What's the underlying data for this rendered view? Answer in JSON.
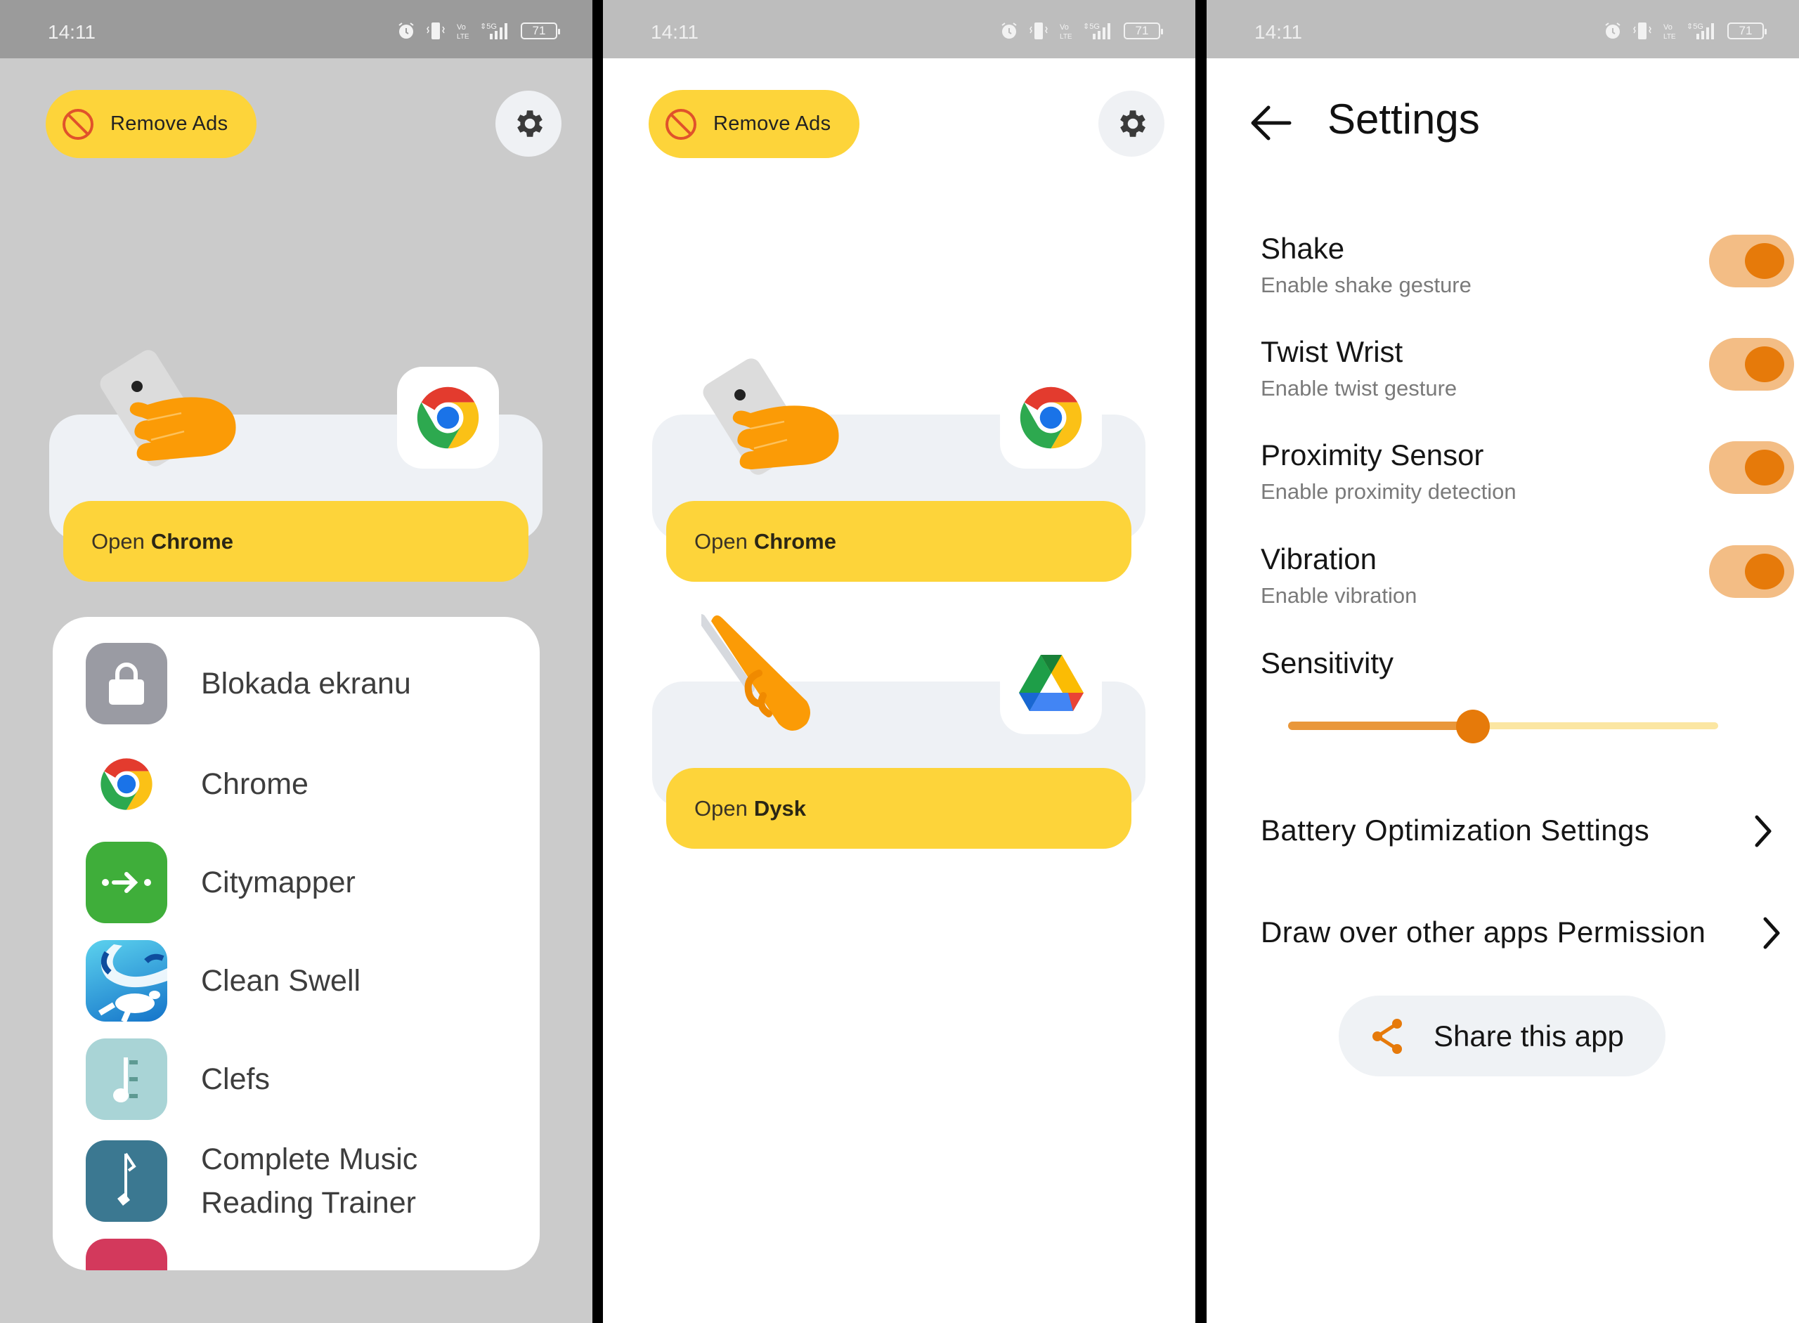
{
  "status_bar": {
    "time": "14:11",
    "icons": [
      "alarm-icon",
      "vibrate-icon",
      "volte-icon",
      "5g-signal-icon",
      "battery-icon"
    ],
    "volte_label": "Vo LTE",
    "network_label": "5G",
    "battery_level": "71"
  },
  "home": {
    "remove_ads_label": "Remove Ads",
    "settings_icon": "gear-icon",
    "gestures": [
      {
        "gesture": "shake-hand",
        "app": "Chrome",
        "open_prefix": "Open",
        "open_app": "Chrome"
      },
      {
        "gesture": "swipe-hand",
        "app": "Dysk",
        "open_prefix": "Open",
        "open_app": "Dysk"
      }
    ]
  },
  "app_picker": {
    "items": [
      {
        "name": "Blokada ekranu",
        "icon": "lock-icon",
        "color": "#9a9ba3"
      },
      {
        "name": "Chrome",
        "icon": "chrome-icon",
        "color": "#ffffff"
      },
      {
        "name": "Citymapper",
        "icon": "citymapper-icon",
        "color": "#3fae3a"
      },
      {
        "name": "Clean Swell",
        "icon": "wave-turtle-icon",
        "color": "#1e90d6"
      },
      {
        "name": "Clefs",
        "icon": "music-note-icon",
        "color": "#a9d4d6"
      },
      {
        "name": "Complete Music Reading Trainer",
        "name_line1": "Complete Music",
        "name_line2": "Reading Trainer",
        "icon": "eighth-note-icon",
        "color": "#3b7891"
      }
    ]
  },
  "settings": {
    "title": "Settings",
    "toggles": [
      {
        "title": "Shake",
        "subtitle": "Enable shake gesture",
        "enabled": true
      },
      {
        "title": "Twist Wrist",
        "subtitle": "Enable twist gesture",
        "enabled": true
      },
      {
        "title": "Proximity Sensor",
        "subtitle": "Enable proximity detection",
        "enabled": true
      },
      {
        "title": "Vibration",
        "subtitle": "Enable vibration",
        "enabled": true
      }
    ],
    "sensitivity": {
      "label": "Sensitivity",
      "value": 0.43
    },
    "links": [
      {
        "label": "Battery Optimization Settings"
      },
      {
        "label": "Draw over other apps Permission"
      }
    ],
    "share_label": "Share this app"
  },
  "colors": {
    "accent_yellow": "#fdd43a",
    "accent_orange": "#e67a0a",
    "toggle_track": "#f3bd85",
    "card_bg": "#eef1f5"
  }
}
